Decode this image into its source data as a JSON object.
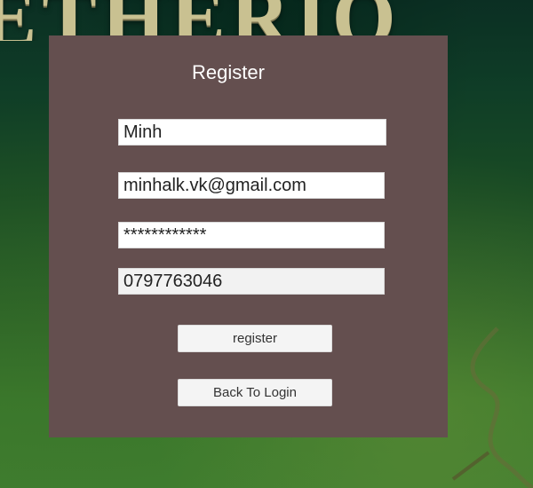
{
  "background": {
    "title_text": "ETHERIO"
  },
  "register_panel": {
    "title": "Register",
    "name_value": "Minh",
    "email_value": "minhalk.vk@gmail.com",
    "password_mask": "************",
    "phone_value": "0797763046",
    "register_button_label": "register",
    "back_button_label": "Back To Login"
  },
  "colors": {
    "panel": "#644f4f",
    "field": "#ffffff",
    "button": "#f4f4f4",
    "title_text": "#c9c191"
  }
}
